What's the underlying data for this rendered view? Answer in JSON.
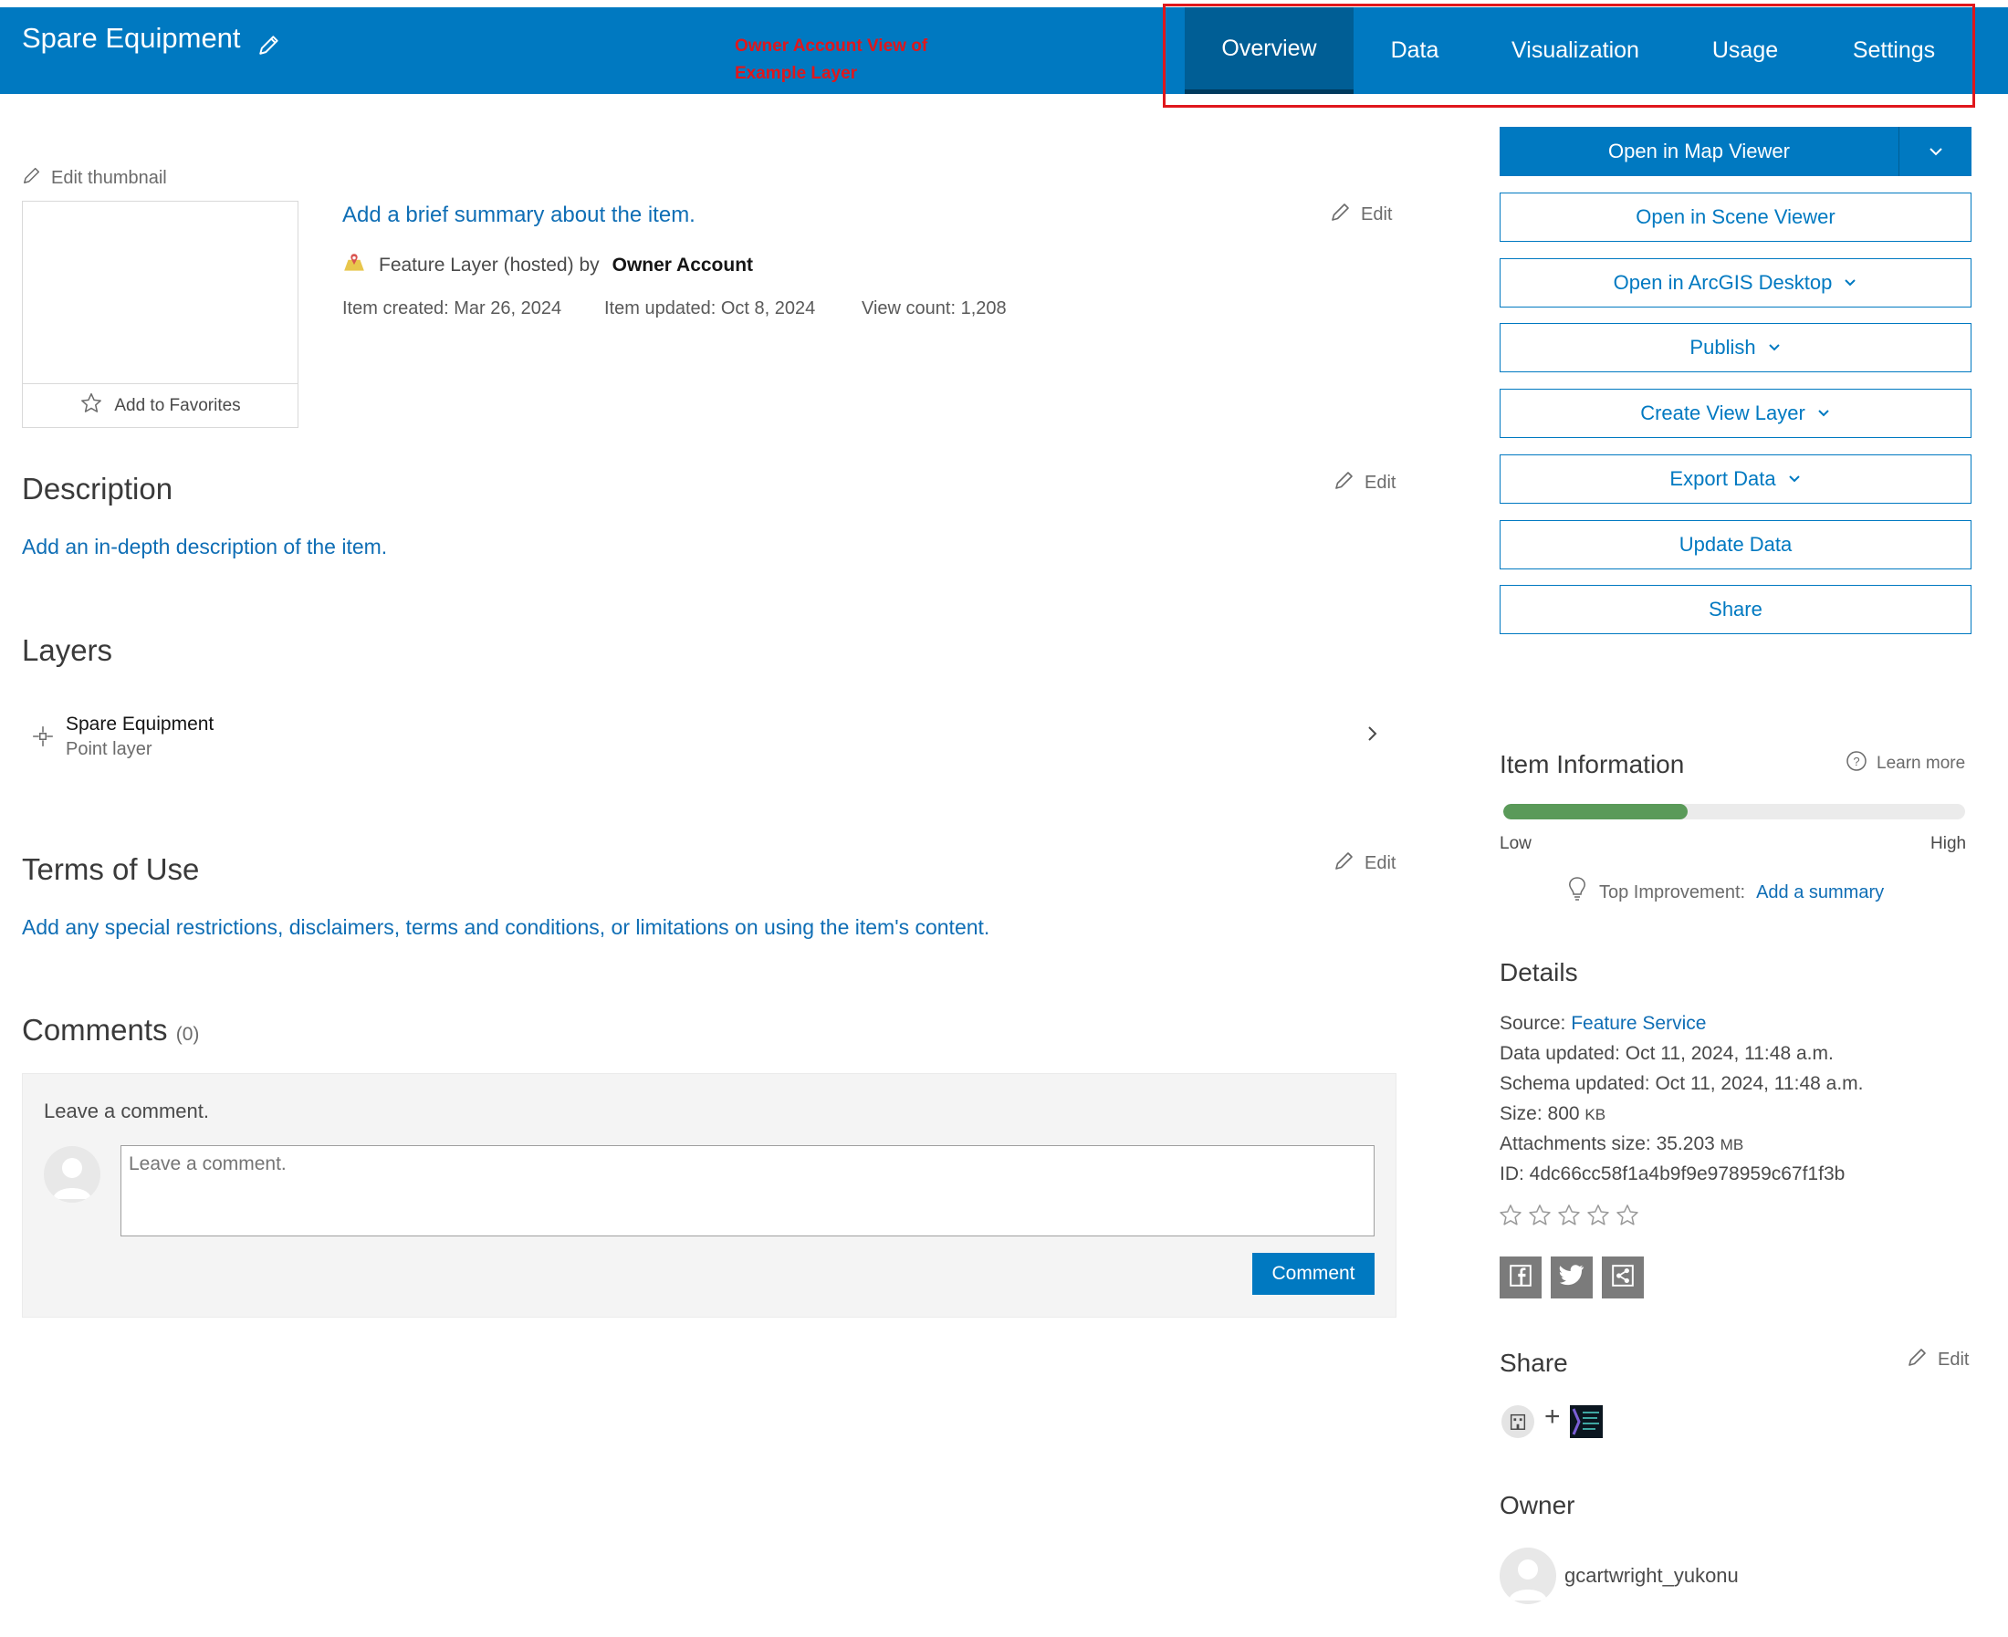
{
  "header": {
    "title": "Spare Equipment",
    "annotation": "Owner Account View of Example Layer",
    "tabs": [
      {
        "label": "Overview"
      },
      {
        "label": "Data"
      },
      {
        "label": "Visualization"
      },
      {
        "label": "Usage"
      },
      {
        "label": "Settings"
      }
    ],
    "active_tab": "Overview"
  },
  "thumbnail": {
    "edit_label": "Edit thumbnail",
    "favorites_label": "Add to Favorites"
  },
  "summary": {
    "summary_link": "Add a brief summary about the item.",
    "edit_label": "Edit",
    "type_text": "Feature Layer (hosted) by",
    "owner": "Owner Account",
    "created": "Item created: Mar 26, 2024",
    "updated": "Item updated: Oct 8, 2024",
    "views": "View count: 1,208"
  },
  "description": {
    "heading": "Description",
    "edit_label": "Edit",
    "link": "Add an in-depth description of the item."
  },
  "layers": {
    "heading": "Layers",
    "items": [
      {
        "name": "Spare Equipment",
        "type": "Point layer"
      }
    ]
  },
  "terms": {
    "heading": "Terms of Use",
    "edit_label": "Edit",
    "link": "Add any special restrictions, disclaimers, terms and conditions, or limitations on using the item's content."
  },
  "comments": {
    "heading": "Comments",
    "count": "(0)",
    "prompt": "Leave a comment.",
    "placeholder": "Leave a comment.",
    "button": "Comment"
  },
  "actions": {
    "primary": "Open in Map Viewer",
    "buttons": [
      {
        "label": "Open in Scene Viewer",
        "dropdown": false
      },
      {
        "label": "Open in ArcGIS Desktop",
        "dropdown": true
      },
      {
        "label": "Publish",
        "dropdown": true
      },
      {
        "label": "Create View Layer",
        "dropdown": true
      },
      {
        "label": "Export Data",
        "dropdown": true
      },
      {
        "label": "Update Data",
        "dropdown": false
      },
      {
        "label": "Share",
        "dropdown": false
      }
    ]
  },
  "item_info": {
    "heading": "Item Information",
    "learn_more": "Learn more",
    "score_fraction": 0.4,
    "low": "Low",
    "high": "High",
    "top_improvement_label": "Top Improvement:",
    "top_improvement_link": "Add a summary"
  },
  "details": {
    "heading": "Details",
    "source_label": "Source:",
    "source_value": "Feature Service",
    "data_updated": "Data updated: Oct 11, 2024, 11:48 a.m.",
    "schema_updated": "Schema updated: Oct 11, 2024, 11:48 a.m.",
    "size_label": "Size: 800",
    "size_unit": "KB",
    "attachments_label": "Attachments size: 35.203",
    "attachments_unit": "MB",
    "id": "ID: 4dc66cc58f1a4b9f9e978959c67f1f3b",
    "rating_stars": 5
  },
  "share": {
    "heading": "Share",
    "edit_label": "Edit",
    "plus": "+"
  },
  "owner": {
    "heading": "Owner",
    "name": "gcartwright_yukonu"
  },
  "colors": {
    "brand_blue": "#0079c1",
    "active_tab": "#005e95",
    "annotation_red": "#e0171c",
    "score_green": "#5a9a59"
  }
}
